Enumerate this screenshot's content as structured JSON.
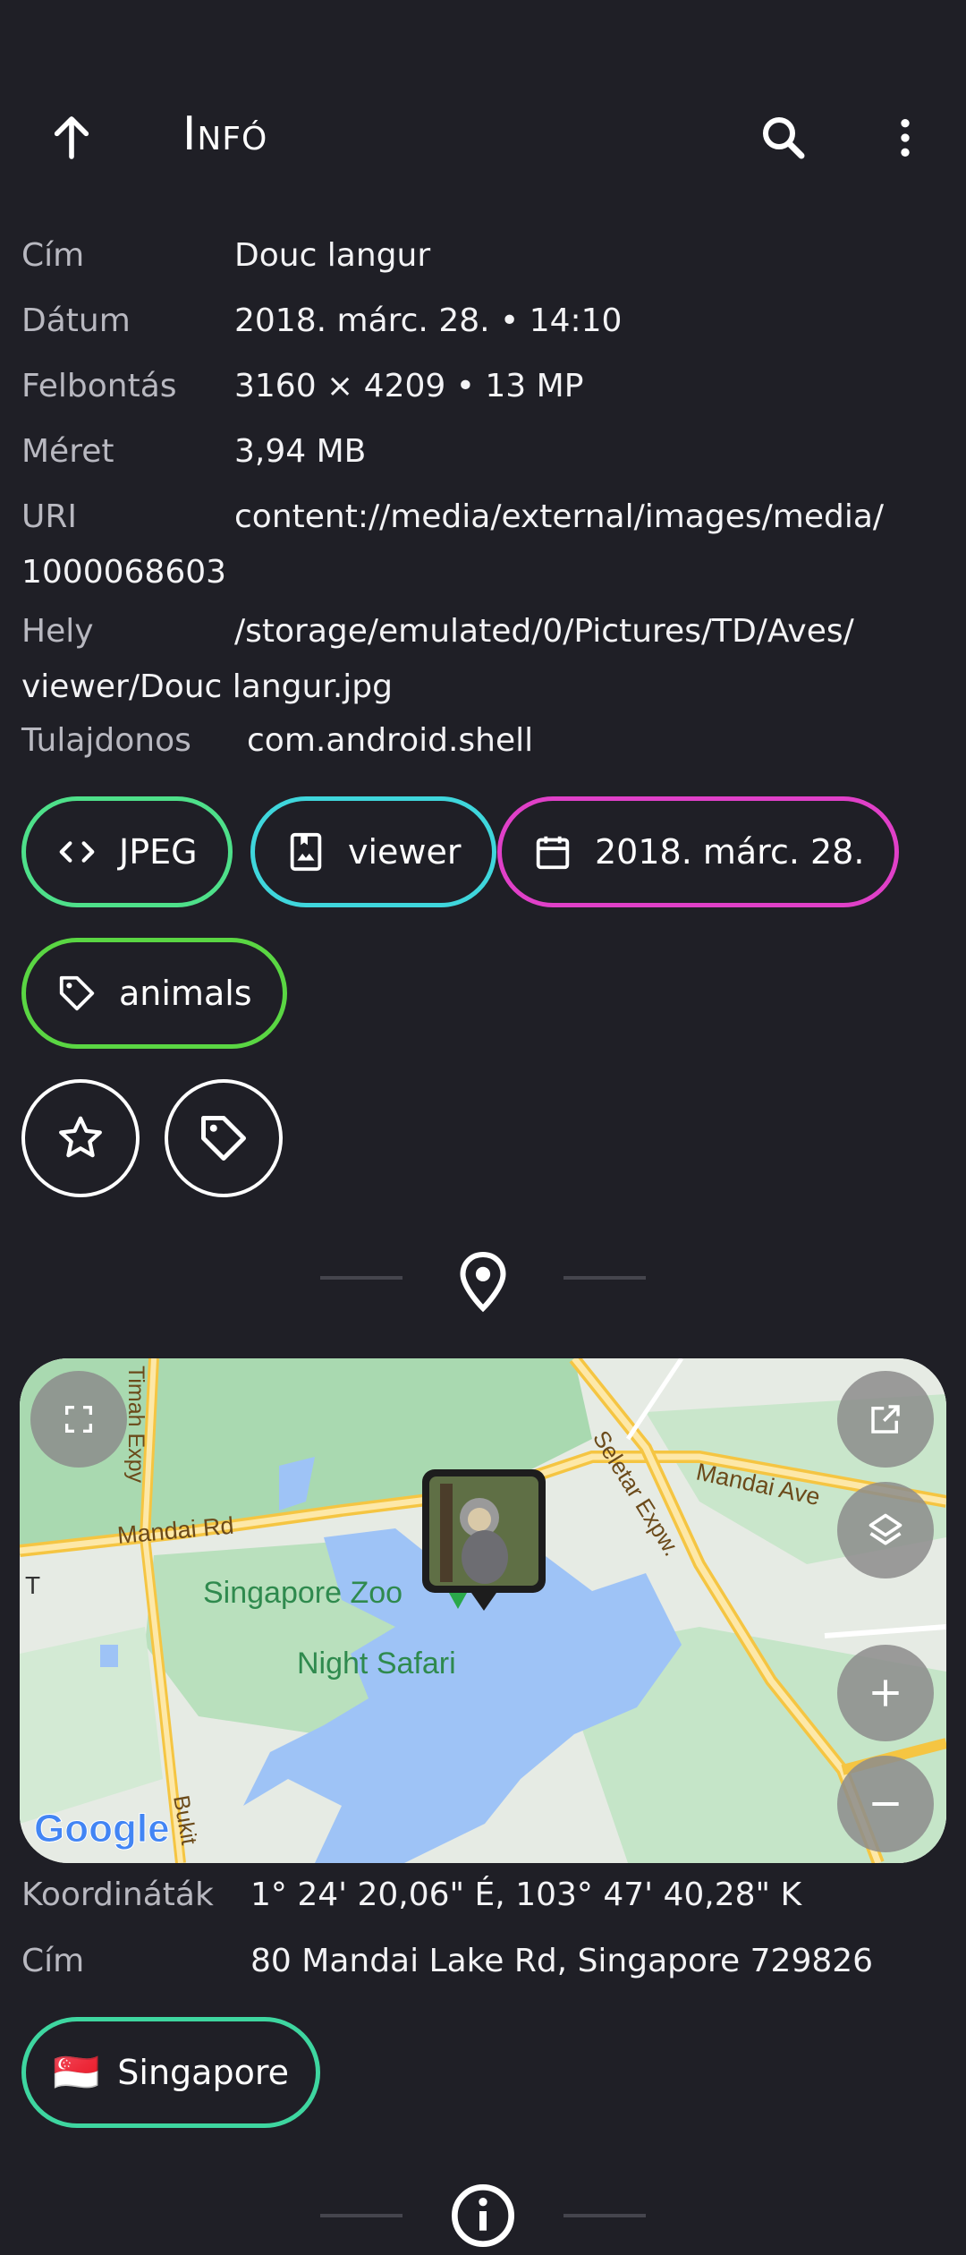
{
  "appbar": {
    "title": "Infó"
  },
  "details": [
    {
      "key": "Cím",
      "value": "Douc langur"
    },
    {
      "key": "Dátum",
      "value": "2018. márc. 28. • 14:10"
    },
    {
      "key": "Felbontás",
      "value": "3160 × 4209 • 13 MP"
    },
    {
      "key": "Méret",
      "value": "3,94 MB"
    },
    {
      "key": "URI",
      "value": "content://media/external/images/media/",
      "value2": "1000068603"
    },
    {
      "key": "Hely",
      "value": "/storage/emulated/0/Pictures/TD/Aves/",
      "value2": "viewer/Douc langur.jpg"
    },
    {
      "key": "Tulajdonos",
      "value": "com.android.shell"
    }
  ],
  "chips": [
    {
      "label": "JPEG",
      "icon": "code-icon",
      "color": "#4ee08a"
    },
    {
      "label": "viewer",
      "icon": "album-icon",
      "color": "#3fd6dc"
    },
    {
      "label": "2018. márc. 28.",
      "icon": "calendar-icon",
      "color": "#e040c8"
    },
    {
      "label": "animals",
      "icon": "tag-icon",
      "color": "#5ad643"
    }
  ],
  "map": {
    "labels": {
      "singapore_zoo": "Singapore Zoo",
      "night_safari": "Night Safari",
      "mandai_rd": "Mandai Rd",
      "mandai_ave": "Mandai Ave",
      "seletar_expw": "Seletar Expw.",
      "timah_expy": "Timah Expy",
      "bukit": "Bukit",
      "t_left": "T",
      "google": "Google"
    }
  },
  "location": {
    "coords_key": "Koordináták",
    "coords_value": "1° 24' 20,06\" É, 103° 47' 40,28\" K",
    "address_key": "Cím",
    "address_value": "80 Mandai Lake Rd, Singapore 729826",
    "country_chip": "Singapore",
    "country_flag": "🇸🇬",
    "country_color": "#3ed6a0"
  }
}
